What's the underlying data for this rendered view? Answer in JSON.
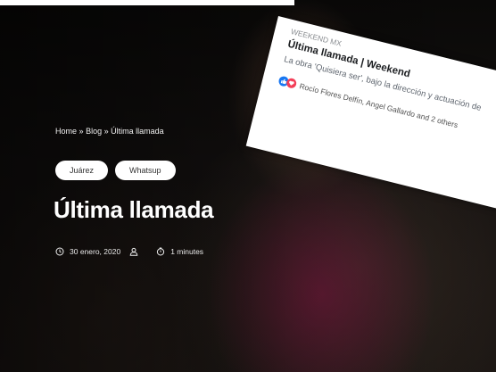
{
  "breadcrumb": {
    "home": "Home",
    "sep1": "»",
    "blog": "Blog",
    "sep2": "»",
    "current": "Última llamada"
  },
  "tags": [
    "Juárez",
    "Whatsup"
  ],
  "post": {
    "title": "Última llamada",
    "date": "30 enero, 2020",
    "author": "",
    "read_time": "1 minutes"
  },
  "icons": {
    "date": "clock-icon",
    "author": "user-icon",
    "read_time": "timer-icon"
  },
  "facebook_card": {
    "source": "WEEKEND MX",
    "title": "Última llamada | Weekend",
    "description": "La obra 'Quisiera ser', bajo la dirección y actuación de",
    "reactions_text": "Rocío Flores Delfín, Angel Gallardo and 2 others",
    "like_color": "#1877f2",
    "love_color": "#f33e58"
  }
}
